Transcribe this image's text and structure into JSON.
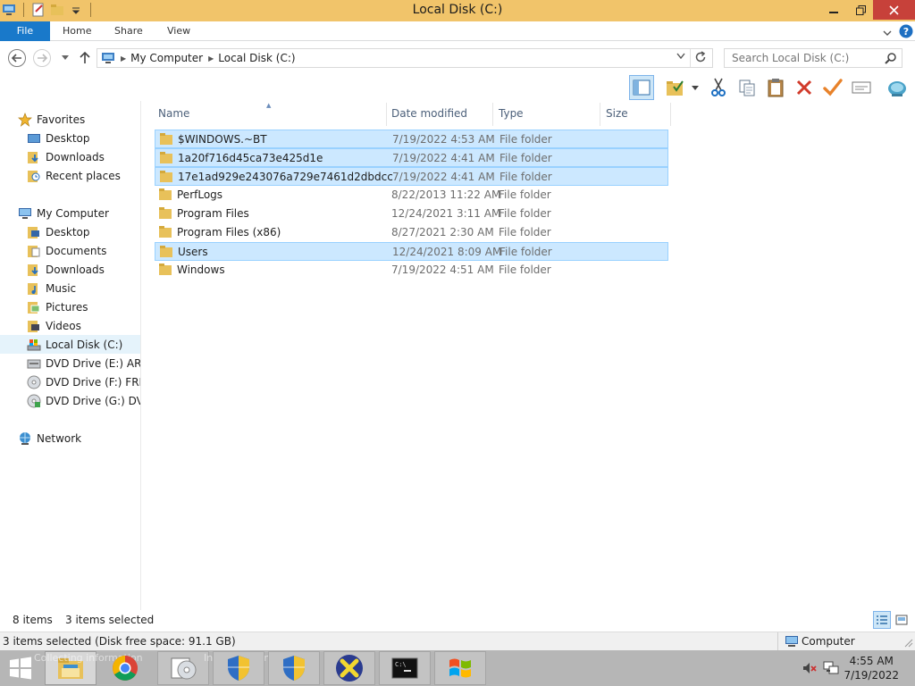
{
  "window": {
    "title": "Local Disk (C:)"
  },
  "ribbon": {
    "tabs": [
      "File",
      "Home",
      "Share",
      "View"
    ]
  },
  "address": {
    "crumbs": [
      "My Computer",
      "Local Disk (C:)"
    ],
    "search_placeholder": "Search Local Disk (C:)"
  },
  "navigation": {
    "favorites": {
      "label": "Favorites",
      "items": [
        "Desktop",
        "Downloads",
        "Recent places"
      ]
    },
    "computer": {
      "label": "My Computer",
      "items": [
        "Desktop",
        "Documents",
        "Downloads",
        "Music",
        "Pictures",
        "Videos",
        "Local Disk (C:)",
        "DVD Drive (E:) ARMF",
        "DVD Drive (F:) FRMC",
        "DVD Drive (G:) DVD_"
      ]
    },
    "network": {
      "label": "Network"
    },
    "selected": "Local Disk (C:)"
  },
  "file_list": {
    "columns": [
      "Name",
      "Date modified",
      "Type",
      "Size"
    ],
    "rows": [
      {
        "name": "$WINDOWS.~BT",
        "date": "7/19/2022 4:53 AM",
        "type": "File folder",
        "selected": true
      },
      {
        "name": "1a20f716d45ca73e425d1e",
        "date": "7/19/2022 4:41 AM",
        "type": "File folder",
        "selected": true
      },
      {
        "name": "17e1ad929e243076a729e7461d2dbdcc",
        "date": "7/19/2022 4:41 AM",
        "type": "File folder",
        "selected": true
      },
      {
        "name": "PerfLogs",
        "date": "8/22/2013 11:22 AM",
        "type": "File folder",
        "selected": false
      },
      {
        "name": "Program Files",
        "date": "12/24/2021 3:11 AM",
        "type": "File folder",
        "selected": false
      },
      {
        "name": "Program Files (x86)",
        "date": "8/27/2021 2:30 AM",
        "type": "File folder",
        "selected": false
      },
      {
        "name": "Users",
        "date": "12/24/2021 8:09 AM",
        "type": "File folder",
        "selected": true
      },
      {
        "name": "Windows",
        "date": "7/19/2022 4:51 AM",
        "type": "File folder",
        "selected": false
      }
    ]
  },
  "status": {
    "item_count": "8 items",
    "selected_count": "3 items selected",
    "detail": "3 items selected (Disk free space: 91.1 GB)",
    "location": "Computer"
  },
  "taskbar": {
    "ghost_text_1": "Collecting information",
    "ghost_text_2": "Installing Windows",
    "clock_time": "4:55 AM",
    "clock_date": "7/19/2022"
  },
  "colors": {
    "titlebar": "#f1c46a",
    "file_tab": "#1979ca",
    "selection": "#cce8ff",
    "close": "#c7413a"
  }
}
